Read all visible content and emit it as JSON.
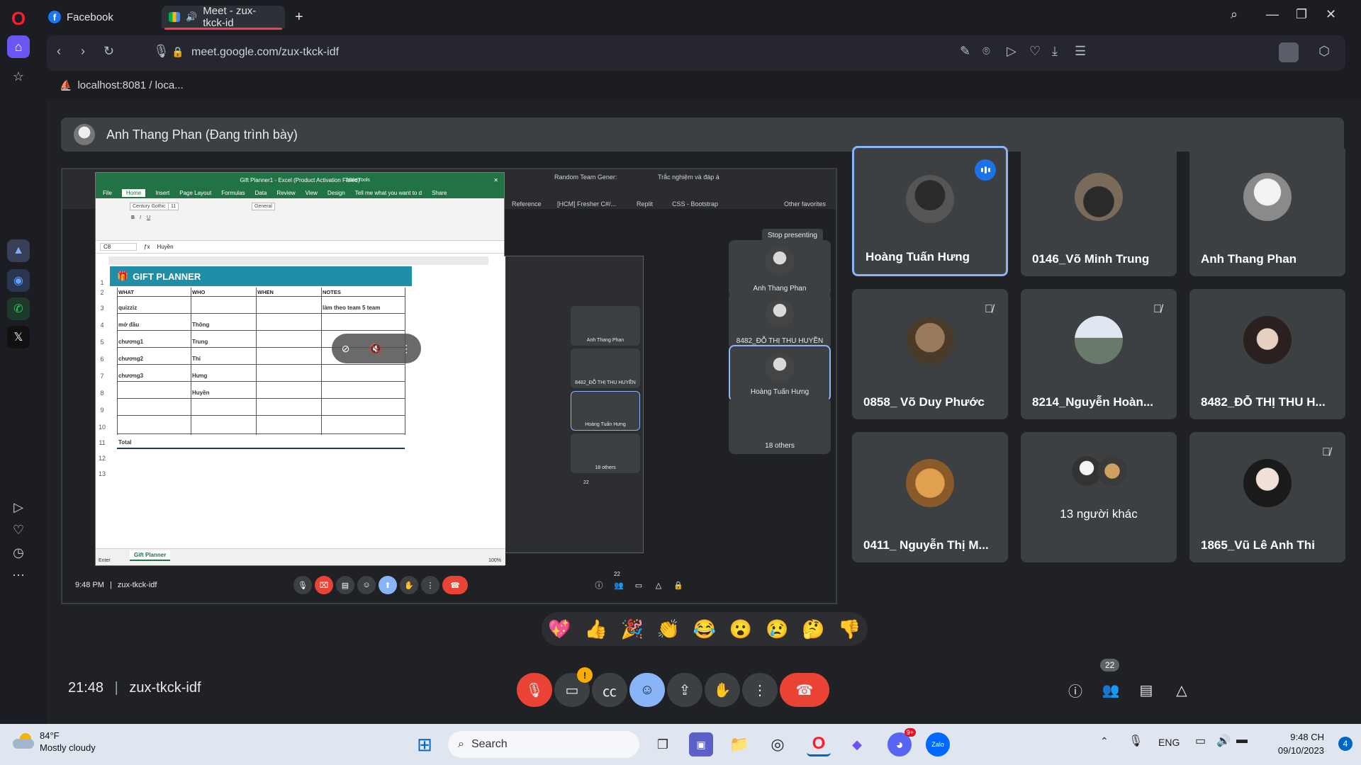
{
  "browser": {
    "tabs": [
      {
        "label": "Facebook"
      },
      {
        "label": "Meet - zux-tkck-id"
      }
    ],
    "url": "meet.google.com/zux-tkck-idf",
    "bookmark": "localhost:8081 / loca..."
  },
  "meet": {
    "presenter_label": "Anh Thang Phan (Đang trình bày)",
    "participants": [
      {
        "name": "Hoàng Tuấn Hưng",
        "speaking": true
      },
      {
        "name": "0146_Võ Minh Trung"
      },
      {
        "name": "Anh Thang Phan"
      },
      {
        "name": "0858_ Võ Duy Phước",
        "muted": true
      },
      {
        "name": "8214_Nguyễn Hoàn...",
        "muted": true
      },
      {
        "name": "8482_ĐỖ THỊ THU H..."
      },
      {
        "name": "0411_ Nguyễn Thị M..."
      },
      {
        "name": "13 người khác"
      },
      {
        "name": "1865_Vũ Lê Anh Thi",
        "muted": true
      }
    ],
    "reactions": [
      "💖",
      "👍",
      "🎉",
      "👏",
      "😂",
      "😮",
      "😢",
      "🤔",
      "👎"
    ],
    "time": "21:48",
    "meeting_code": "zux-tkck-idf",
    "participant_count": "22",
    "camera_notice": "!"
  },
  "shared": {
    "excel_title": "Gift Planner1 - Excel (Product Activation Failed)",
    "table_tools": "Table Tools",
    "menu": [
      "File",
      "Home",
      "Insert",
      "Page Layout",
      "Formulas",
      "Data",
      "Review",
      "View",
      "Design"
    ],
    "tell_me": "Tell me what you want to d",
    "share": "Share",
    "font": "Century Gothic",
    "font_size": "11",
    "number_format": "General",
    "cell_ref": "C8",
    "formula_value": "Huyền",
    "banner": "GIFT PLANNER",
    "headers": [
      "WHAT",
      "WHO",
      "WHEN",
      "NOTES"
    ],
    "rows": [
      {
        "what": "quizziz",
        "who": "",
        "notes": "làm theo team 5 team"
      },
      {
        "what": "mở đầu",
        "who": "Thông",
        "notes": ""
      },
      {
        "what": "chương1",
        "who": "Trung",
        "notes": ""
      },
      {
        "what": "chương2",
        "who": "Thi",
        "notes": ""
      },
      {
        "what": "chương3",
        "who": "Hưng",
        "notes": ""
      },
      {
        "what": "",
        "who": "Huyền",
        "notes": ""
      }
    ],
    "total_label": "Total",
    "sheet_tab": "Gift Planner",
    "status": "Enter",
    "zoom": "100%",
    "inner_tabs": [
      "Random Team Gener:",
      "Trắc nghiệm và đáp á"
    ],
    "inner_bookmarks": [
      "Reference",
      "[HCM] Fresher C#/...",
      "Replit",
      "CSS - Bootstrap",
      "Other favorites"
    ],
    "stop_presenting": "Stop presenting",
    "side_tiles": [
      "Anh Thang Phan",
      "8482_ĐỖ THỊ THU HUYỀN",
      "Hoàng Tuấn Hưng",
      "18 others"
    ],
    "nested_tiles": [
      "Anh Thang Phan",
      "8482_ĐỖ THỊ THU HUYỀN",
      "Hoàng Tuấn Hưng",
      "18 others"
    ],
    "inner_time": "9:48 PM",
    "inner_code": "zux-tkck-idf",
    "nested_count": "22",
    "inner_count": "22"
  },
  "taskbar": {
    "temp": "84°F",
    "weather": "Mostly cloudy",
    "search": "Search",
    "lang": "ENG",
    "time": "9:48 CH",
    "date": "09/10/2023",
    "notif": "4",
    "discord_badge": "9+",
    "zalo": "Zalo"
  },
  "colors": {
    "meet_bg": "#202124",
    "tile_bg": "#3c4043",
    "highlight": "#8ab4f8",
    "red": "#ea4335",
    "excel_green": "#217346",
    "banner_teal": "#1f8fa8"
  }
}
